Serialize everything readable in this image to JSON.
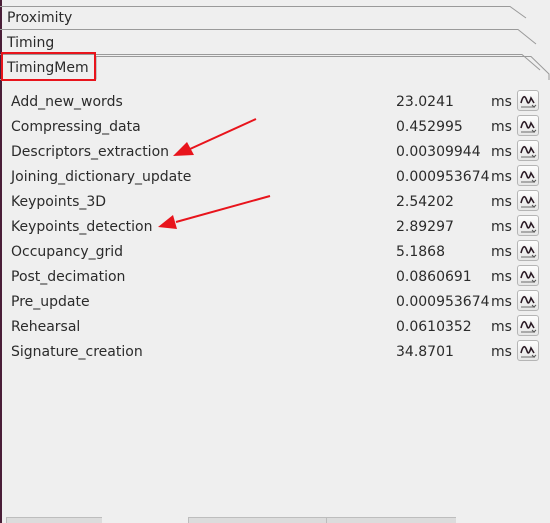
{
  "tabs": {
    "proximity": "Proximity",
    "timing": "Timing",
    "timingmem": "TimingMem"
  },
  "unit": "ms",
  "rows": [
    {
      "label": "Add_new_words",
      "value": "23.0241"
    },
    {
      "label": "Compressing_data",
      "value": "0.452995"
    },
    {
      "label": "Descriptors_extraction",
      "value": "0.00309944"
    },
    {
      "label": "Joining_dictionary_update",
      "value": "0.000953674"
    },
    {
      "label": "Keypoints_3D",
      "value": "2.54202"
    },
    {
      "label": "Keypoints_detection",
      "value": "2.89297"
    },
    {
      "label": "Occupancy_grid",
      "value": "5.1868"
    },
    {
      "label": "Post_decimation",
      "value": "0.0860691"
    },
    {
      "label": "Pre_update",
      "value": "0.000953674"
    },
    {
      "label": "Rehearsal",
      "value": "0.0610352"
    },
    {
      "label": "Signature_creation",
      "value": "34.8701"
    }
  ],
  "icons": {
    "plot": "plot-icon",
    "annotation_arrow": "arrow-icon"
  },
  "colors": {
    "highlight": "#e8141c",
    "background": "#efefef",
    "plot_curve": "#2a1a24"
  }
}
